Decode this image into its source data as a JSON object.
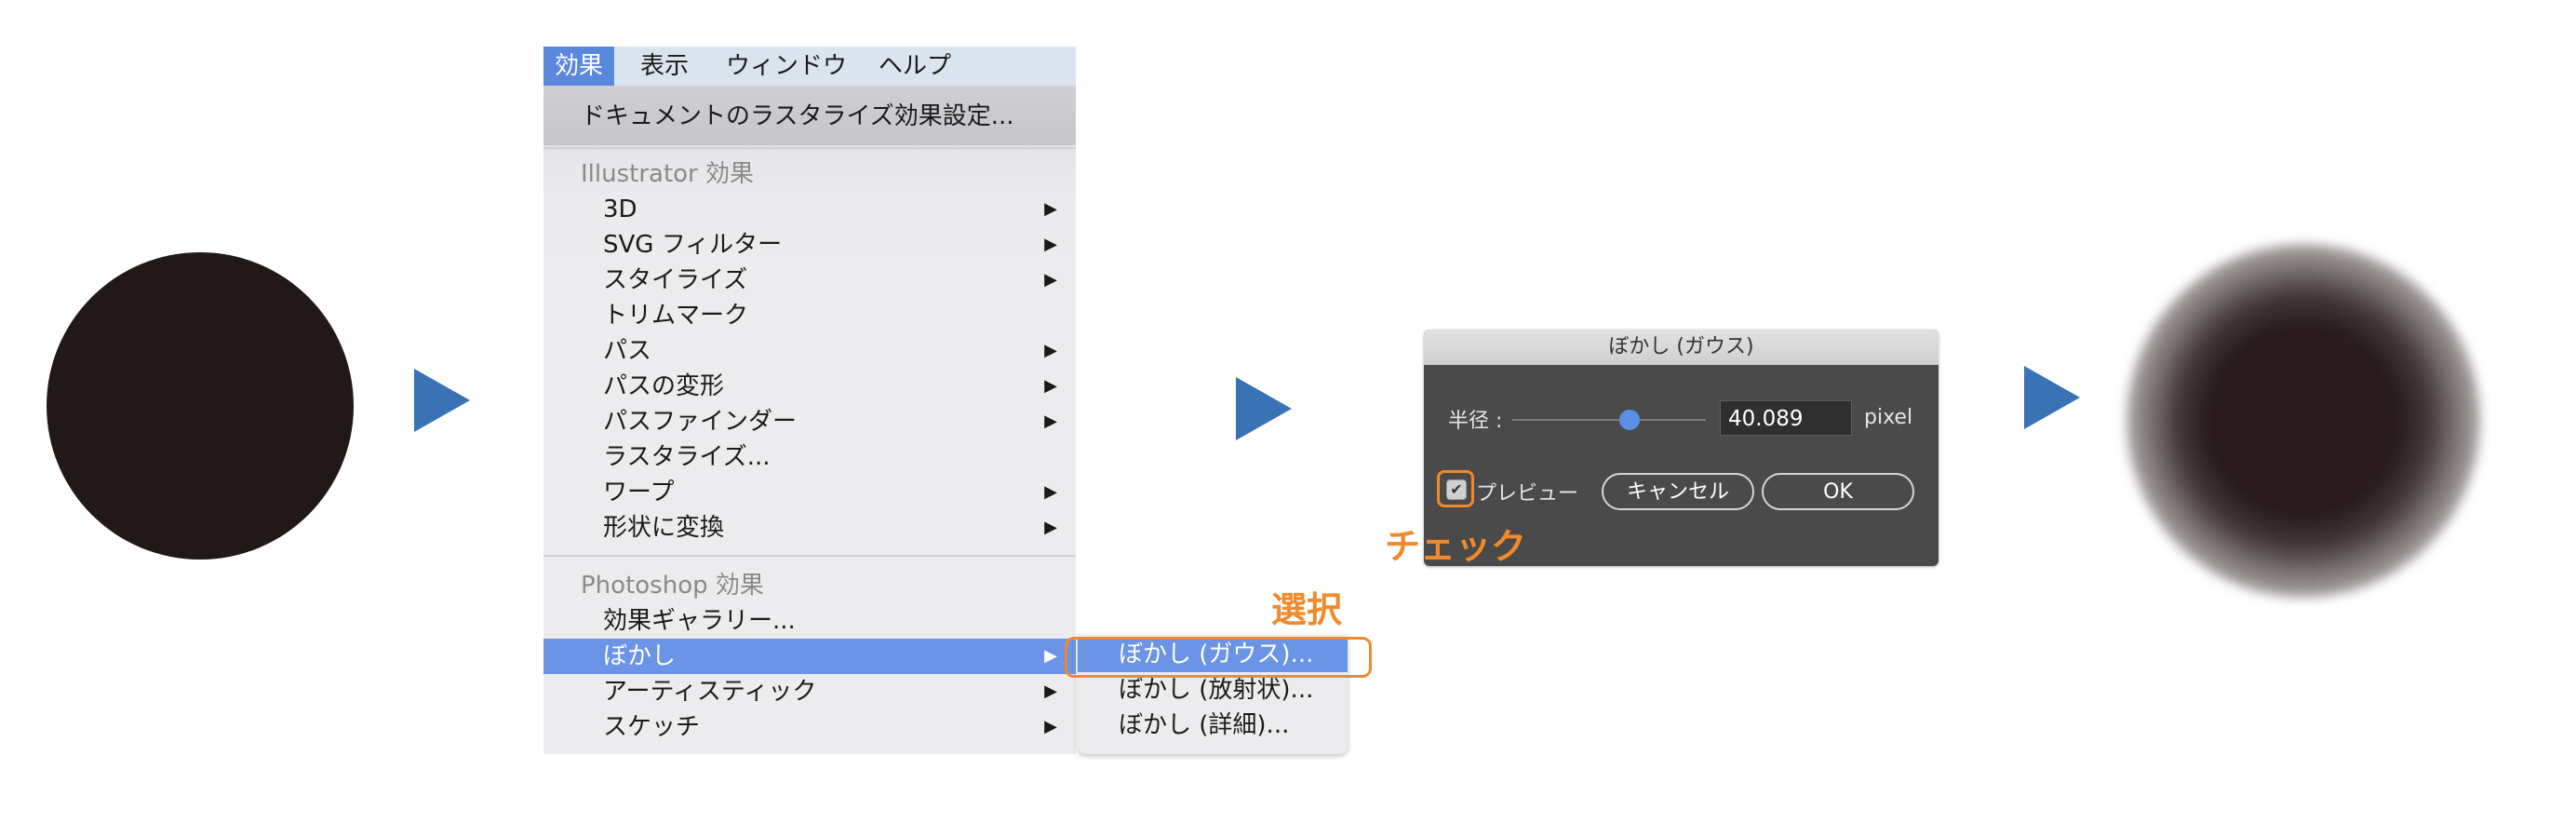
{
  "menubar": {
    "items": [
      "効果",
      "表示",
      "ウィンドウ",
      "ヘルプ"
    ]
  },
  "menu": {
    "rasterize_settings": "ドキュメントのラスタライズ効果設定...",
    "illustrator_header": "Illustrator 効果",
    "illustrator_items": [
      "3D",
      "SVG フィルター",
      "スタイライズ",
      "トリムマーク",
      "パス",
      "パスの変形",
      "パスファインダー",
      "ラスタライズ...",
      "ワープ",
      "形状に変換"
    ],
    "photoshop_header": "Photoshop 効果",
    "photoshop_items": [
      "効果ギャラリー...",
      "ぼかし",
      "アーティスティック",
      "スケッチ"
    ],
    "submenu_arrow": "▶"
  },
  "submenu": {
    "items": [
      "ぼかし (ガウス)...",
      "ぼかし (放射状)...",
      "ぼかし (詳細)..."
    ]
  },
  "annotations": {
    "select": "選択",
    "check": "チェック"
  },
  "dialog": {
    "title": "ぼかし (ガウス)",
    "radius_label": "半径 :",
    "radius_value": "40.089",
    "unit": "pixel",
    "preview_label": "プレビュー",
    "cancel": "キャンセル",
    "ok": "OK"
  },
  "colors": {
    "arrow": "#3a72b6",
    "annotation": "#f08a2c",
    "menu_highlight": "#6b93e6",
    "circle": "#231818"
  }
}
